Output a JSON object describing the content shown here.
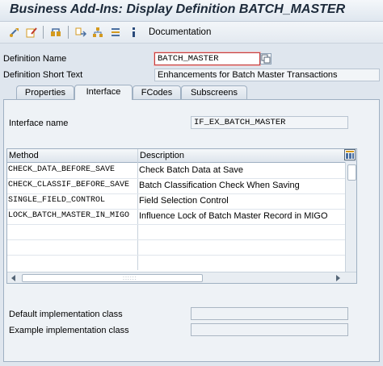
{
  "window": {
    "title": "Business Add-Ins: Display Definition BATCH_MASTER"
  },
  "toolbar": {
    "icons": [
      "other-object-icon",
      "display-change-icon",
      "object-list-icon",
      "where-used-icon",
      "navigation-icon",
      "hierarchy-icon",
      "info-icon"
    ],
    "documentation_label": "Documentation"
  },
  "header": {
    "definition_name_label": "Definition Name",
    "definition_name_value": "BATCH_MASTER",
    "short_text_label": "Definition Short Text",
    "short_text_value": "Enhancements for Batch Master Transactions"
  },
  "tabs": [
    {
      "label": "Properties",
      "active": false
    },
    {
      "label": "Interface",
      "active": true
    },
    {
      "label": "FCodes",
      "active": false
    },
    {
      "label": "Subscreens",
      "active": false
    }
  ],
  "interface": {
    "name_label": "Interface name",
    "name_value": "IF_EX_BATCH_MASTER"
  },
  "methods_table": {
    "columns": [
      "Method",
      "Description"
    ],
    "rows": [
      {
        "method": "CHECK_DATA_BEFORE_SAVE",
        "description": "Check Batch Data at Save"
      },
      {
        "method": "CHECK_CLASSIF_BEFORE_SAVE",
        "description": "Batch Classification Check When Saving"
      },
      {
        "method": "SINGLE_FIELD_CONTROL",
        "description": "Field Selection Control"
      },
      {
        "method": "LOCK_BATCH_MASTER_IN_MIGO",
        "description": "Influence Lock of Batch Master Record in MIGO"
      }
    ]
  },
  "footer": {
    "default_impl_label": "Default implementation class",
    "default_impl_value": "",
    "example_impl_label": "Example implementation class",
    "example_impl_value": ""
  },
  "colors": {
    "accent": "#c23d3d",
    "panel": "#eef2f6",
    "border": "#9fb0c2",
    "toolbar_icon": "#d49a1f"
  }
}
